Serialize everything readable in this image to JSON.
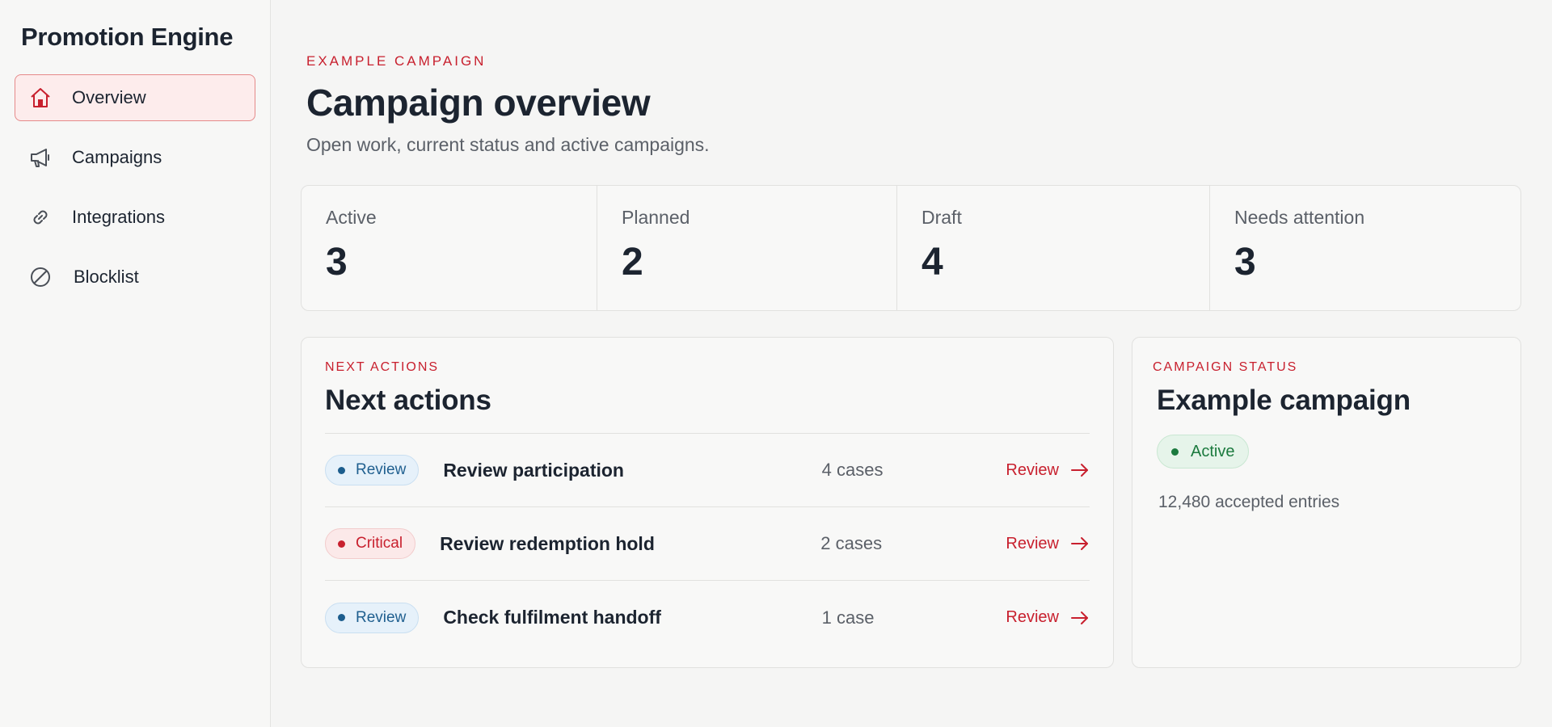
{
  "sidebar": {
    "brand": "Promotion Engine",
    "items": [
      {
        "label": "Overview",
        "icon": "home-icon",
        "active": true
      },
      {
        "label": "Campaigns",
        "icon": "megaphone-icon",
        "active": false
      },
      {
        "label": "Integrations",
        "icon": "link-icon",
        "active": false
      },
      {
        "label": "Blocklist",
        "icon": "blocked-icon",
        "active": false
      }
    ]
  },
  "header": {
    "eyebrow": "EXAMPLE CAMPAIGN",
    "title": "Campaign overview",
    "subtitle": "Open work, current status and active campaigns."
  },
  "stats": [
    {
      "label": "Active",
      "value": "3"
    },
    {
      "label": "Planned",
      "value": "2"
    },
    {
      "label": "Draft",
      "value": "4"
    },
    {
      "label": "Needs attention",
      "value": "3"
    }
  ],
  "next_actions": {
    "eyebrow": "NEXT ACTIONS",
    "title": "Next actions",
    "rows": [
      {
        "badge": "Review",
        "badge_type": "review",
        "title": "Review participation",
        "count": "4 cases",
        "link": "Review"
      },
      {
        "badge": "Critical",
        "badge_type": "critical",
        "title": "Review redemption hold",
        "count": "2 cases",
        "link": "Review"
      },
      {
        "badge": "Review",
        "badge_type": "review",
        "title": "Check fulfilment handoff",
        "count": "1 case",
        "link": "Review"
      }
    ]
  },
  "campaign_status": {
    "eyebrow": "CAMPAIGN STATUS",
    "title": "Example campaign",
    "status": "Active",
    "meta": "12,480 accepted entries"
  },
  "colors": {
    "accent": "#c8202e",
    "text": "#1c2430",
    "muted": "#5b6068",
    "success": "#1b7a3e",
    "info": "#1f5f8f"
  }
}
